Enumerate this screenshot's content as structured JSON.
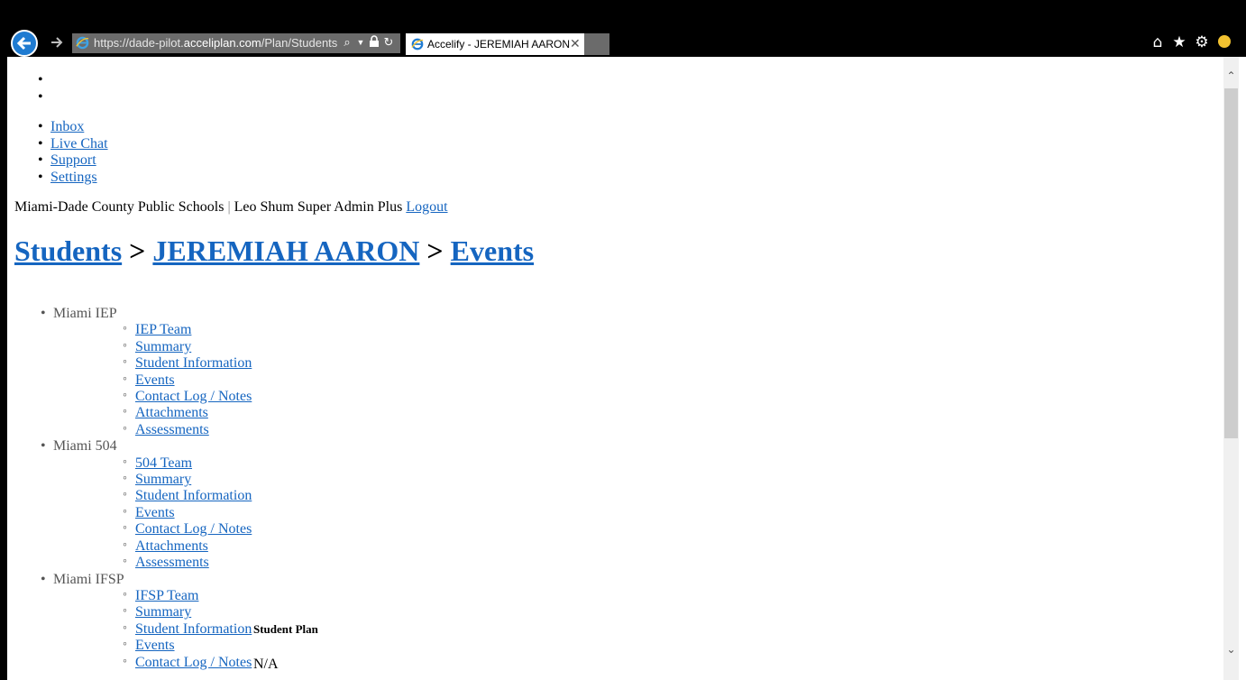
{
  "browser": {
    "url_prefix": "https://dade-pilot.",
    "url_host": "acceliplan.com",
    "url_path": "/Plan/Students/V",
    "tab_title": "Accelify - JEREMIAH AARON",
    "tab_close": "✕"
  },
  "top_nav": [
    "Inbox",
    "Live Chat",
    "Support",
    "Settings"
  ],
  "user_bar": {
    "org": "Miami-Dade County Public Schools",
    "separator": "|",
    "user": "Leo Shum Super Admin Plus",
    "logout": "Logout"
  },
  "breadcrumb": {
    "students": "Students",
    "sep1": ">",
    "student_name": "JEREMIAH AARON",
    "sep2": ">",
    "current": "Events"
  },
  "plans": [
    {
      "name": "Miami IEP",
      "links": [
        "IEP Team",
        "Summary",
        "Student Information",
        "Events",
        "Contact Log / Notes",
        "Attachments",
        "Assessments"
      ]
    },
    {
      "name": "Miami 504",
      "links": [
        "504 Team",
        "Summary",
        "Student Information",
        "Events",
        "Contact Log / Notes",
        "Attachments",
        "Assessments"
      ]
    },
    {
      "name": "Miami IFSP",
      "links": [
        "IFSP Team",
        "Summary",
        "Student Information",
        "Events",
        "Contact Log / Notes"
      ]
    }
  ],
  "student_plan": {
    "label": "Student Plan",
    "value": "N/A"
  },
  "colors": {
    "link": "#1565c0",
    "chrome_bg": "#000000",
    "back_button": "#1f7bd1"
  },
  "icons": [
    "back-arrow-icon",
    "forward-arrow-icon",
    "ie-logo-icon",
    "search-icon",
    "dropdown-icon",
    "lock-icon",
    "refresh-icon",
    "home-icon",
    "favorites-star-icon",
    "settings-gear-icon",
    "feedback-smiley-icon"
  ]
}
